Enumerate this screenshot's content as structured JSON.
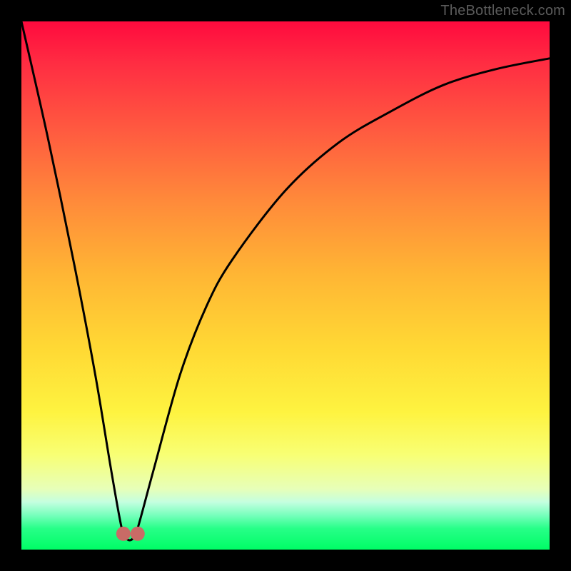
{
  "watermark": "TheBottleneck.com",
  "chart_data": {
    "type": "line",
    "title": "",
    "xlabel": "",
    "ylabel": "",
    "xlim": [
      0,
      100
    ],
    "ylim": [
      0,
      100
    ],
    "grid": false,
    "legend": false,
    "series": [
      {
        "name": "curve",
        "x": [
          0,
          5,
          10,
          14,
          17,
          19,
          20,
          21,
          22,
          25,
          30,
          35,
          40,
          50,
          60,
          70,
          80,
          90,
          100
        ],
        "values": [
          100,
          78,
          54,
          33,
          15,
          4,
          2,
          2,
          4,
          15,
          33,
          46,
          55,
          68,
          77,
          83,
          88,
          91,
          93
        ]
      }
    ],
    "markers": [
      {
        "name": "valley-left",
        "x": 19.3,
        "y": 3
      },
      {
        "name": "valley-right",
        "x": 22.0,
        "y": 3
      }
    ],
    "background_gradient": {
      "direction": "top-to-bottom",
      "stops": [
        {
          "pos": 0.0,
          "color": "#ff0a3e"
        },
        {
          "pos": 0.2,
          "color": "#ff5840"
        },
        {
          "pos": 0.48,
          "color": "#ffb634"
        },
        {
          "pos": 0.74,
          "color": "#fef340"
        },
        {
          "pos": 0.91,
          "color": "#c4ffe0"
        },
        {
          "pos": 1.0,
          "color": "#00fd66"
        }
      ]
    },
    "marker_color": "#c96b66",
    "line_color": "#000000"
  }
}
